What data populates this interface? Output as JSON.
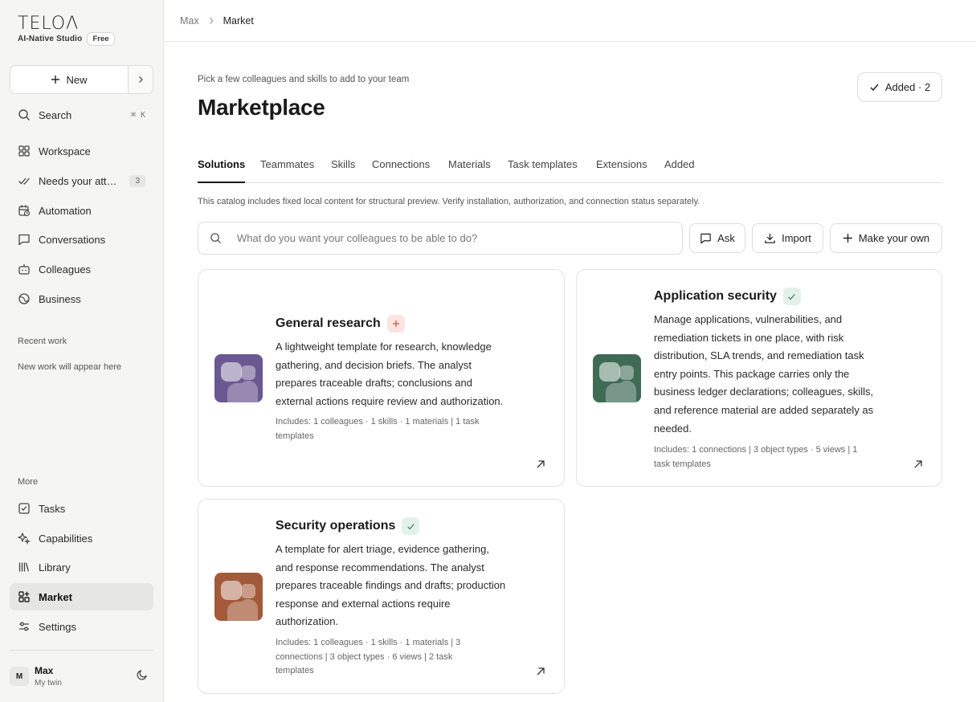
{
  "brand": {
    "logo": "TELOΛ",
    "tagline": "AI-Native Studio",
    "plan": "Free"
  },
  "sidebar": {
    "new_label": "New",
    "search": {
      "label": "Search",
      "shortcut": "⌘ K"
    },
    "items": [
      {
        "label": "Workspace"
      },
      {
        "label": "Needs your attention",
        "badge": "3"
      },
      {
        "label": "Automation"
      },
      {
        "label": "Conversations"
      },
      {
        "label": "Colleagues"
      },
      {
        "label": "Business"
      }
    ],
    "recent_label": "Recent work",
    "recent_empty": "New work will appear here",
    "more_label": "More",
    "more_items": [
      {
        "label": "Tasks"
      },
      {
        "label": "Capabilities"
      },
      {
        "label": "Library"
      },
      {
        "label": "Market"
      },
      {
        "label": "Settings"
      }
    ],
    "user": {
      "initial": "M",
      "name": "Max",
      "subtitle": "My twin"
    }
  },
  "breadcrumb": {
    "root": "Max",
    "current": "Market"
  },
  "header": {
    "eyebrow": "Pick a few colleagues and skills to add to your team",
    "title": "Marketplace",
    "added_button": "Added · 2"
  },
  "tabs": [
    "Solutions",
    "Teammates",
    "Skills",
    "Connections",
    "Materials",
    "Task templates",
    "Extensions",
    "Added"
  ],
  "notice": "This catalog includes fixed local content for structural preview. Verify installation, authorization, and connection status separately.",
  "search": {
    "placeholder": "What do you want your colleagues to be able to do?"
  },
  "toolbar": {
    "ask": "Ask",
    "import": "Import",
    "make_own": "Make your own"
  },
  "colors": {
    "research": "#6b5791",
    "appsec": "#3f6b55",
    "secops": "#a35a3a"
  },
  "cards": [
    {
      "title": "General research",
      "status": "add",
      "desc_lines": [
        "A lightweight template for research, knowledge",
        "gathering, and decision briefs. The analyst",
        "prepares traceable drafts; conclusions and",
        "external actions require review and authorization."
      ],
      "meta_lines": [
        "Includes: 1 colleagues · 1 skills · 1 materials  |  1 task",
        "templates"
      ]
    },
    {
      "title": "Application security",
      "status": "added",
      "desc_lines": [
        "Manage applications, vulnerabilities, and",
        "remediation tickets in one place, with risk",
        "distribution, SLA trends, and remediation task",
        "entry points. This package carries only the",
        "business ledger declarations; colleagues, skills,",
        "and reference material are added separately as",
        "needed."
      ],
      "meta_lines": [
        "Includes: 1 connections  |  3 object types · 5 views  |  1",
        "task templates"
      ]
    },
    {
      "title": "Security operations",
      "status": "added",
      "desc_lines": [
        "A template for alert triage, evidence gathering,",
        "and response recommendations. The analyst",
        "prepares traceable findings and drafts; production",
        "response and external actions require",
        "authorization."
      ],
      "meta_lines": [
        "Includes: 1 colleagues · 1 skills · 1 materials  |  3",
        "connections  |  3 object types · 6 views  |  2 task",
        "templates"
      ]
    }
  ]
}
